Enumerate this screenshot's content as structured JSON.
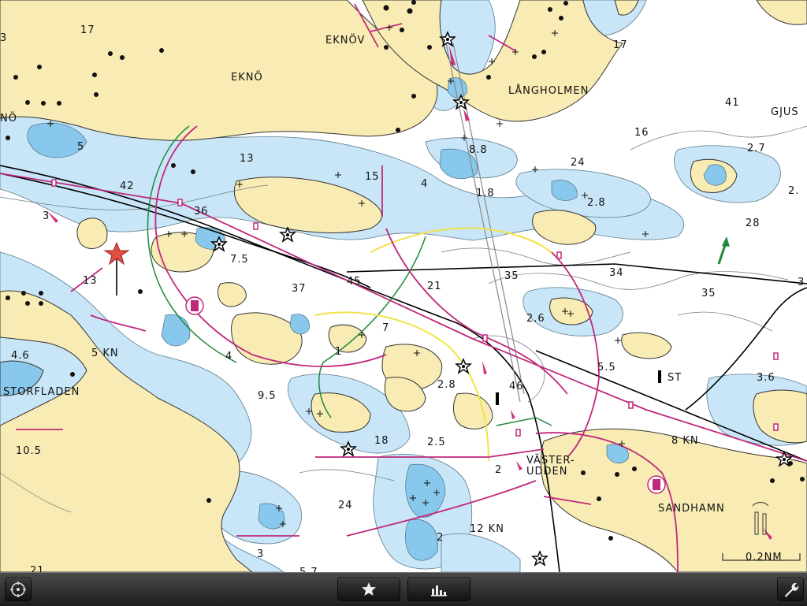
{
  "colors": {
    "land": "#f8ecb4",
    "shallow": "#88c8ec",
    "mid": "#c4e4f6",
    "deep": "#ffffff",
    "route_magenta": "#c0287c",
    "sector_green": "#1f8a3c",
    "sector_yellow": "#f2e24a",
    "toolbar_bg": "#2a2a2a"
  },
  "places": [
    {
      "id": "eknov",
      "text": "EKNÖV"
    },
    {
      "id": "ekno",
      "text": "EKNÖ"
    },
    {
      "id": "langholmen",
      "text": "LÅNGHOLMEN"
    },
    {
      "id": "gjus",
      "text": "GJUS"
    },
    {
      "id": "no",
      "text": "NÖ"
    },
    {
      "id": "storfladen",
      "text": "STORFLADEN"
    },
    {
      "id": "vasterudden1",
      "text": "VÄSTER-"
    },
    {
      "id": "vasterudden2",
      "text": "UDDEN"
    },
    {
      "id": "sandhamn",
      "text": "SANDHAMN"
    }
  ],
  "depths": [
    "17",
    "17",
    "41",
    "16",
    "5",
    "13",
    "15",
    "4",
    "8.8",
    "24",
    "1.8",
    "42",
    "36",
    "3",
    "2.7",
    "2.8",
    "28",
    "2",
    "7.5",
    "13",
    "37",
    "45",
    "21",
    "35",
    "34",
    "35",
    "3",
    "2.6",
    "4.6",
    "5 KN",
    "4",
    "7",
    "1",
    "5.5",
    "ST",
    "2.8",
    "46",
    "3.6",
    "9.5",
    "STORFLADEN_skip",
    "10.5",
    "18",
    "2.5",
    "8 KN",
    "2",
    "24",
    "12 KN",
    "2",
    "3",
    "5.7",
    "21",
    "24",
    "3"
  ],
  "depth_labels": [
    {
      "t": "17"
    },
    {
      "t": "17"
    },
    {
      "t": "41"
    },
    {
      "t": "16"
    },
    {
      "t": "5"
    },
    {
      "t": "13"
    },
    {
      "t": "15"
    },
    {
      "t": "4"
    },
    {
      "t": "8.8"
    },
    {
      "t": "24"
    },
    {
      "t": "1.8"
    },
    {
      "t": "42"
    },
    {
      "t": "36"
    },
    {
      "t": "3"
    },
    {
      "t": "2.7"
    },
    {
      "t": "2.8"
    },
    {
      "t": "28"
    },
    {
      "t": "2."
    },
    {
      "t": "7.5"
    },
    {
      "t": "13"
    },
    {
      "t": "37"
    },
    {
      "t": "45"
    },
    {
      "t": "21"
    },
    {
      "t": "35"
    },
    {
      "t": "34"
    },
    {
      "t": "35"
    },
    {
      "t": "3"
    },
    {
      "t": "2.6"
    },
    {
      "t": "4.6"
    },
    {
      "t": "5 KN"
    },
    {
      "t": "4"
    },
    {
      "t": "7"
    },
    {
      "t": "1"
    },
    {
      "t": "5.5"
    },
    {
      "t": "ST"
    },
    {
      "t": "2.8"
    },
    {
      "t": "46"
    },
    {
      "t": "3.6"
    },
    {
      "t": "9.5"
    },
    {
      "t": "10.5"
    },
    {
      "t": "18"
    },
    {
      "t": "2.5"
    },
    {
      "t": "8 KN"
    },
    {
      "t": "2"
    },
    {
      "t": "24"
    },
    {
      "t": "12 KN"
    },
    {
      "t": "2"
    },
    {
      "t": "3"
    },
    {
      "t": "5.7"
    },
    {
      "t": "21"
    },
    {
      "t": "24"
    },
    {
      "t": "5"
    },
    {
      "t": "3"
    }
  ],
  "scale_bar": {
    "text": "0.2NM"
  },
  "toolbar": {
    "left_button_icon": "crosshair-icon",
    "favorites_icon": "star-icon",
    "chart_icon": "bar-chart-icon",
    "settings_icon": "wrench-icon"
  }
}
